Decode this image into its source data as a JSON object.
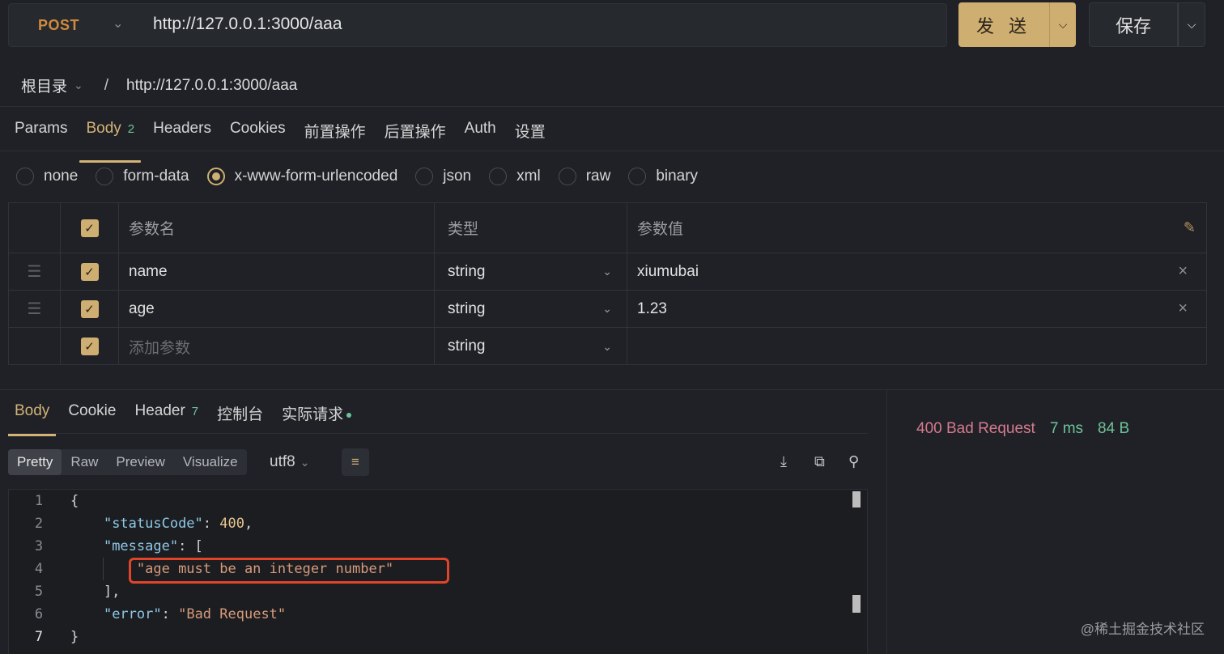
{
  "request": {
    "method": "POST",
    "url": "http://127.0.0.1:3000/aaa",
    "send_label": "发 送",
    "save_label": "保存"
  },
  "breadcrumb": {
    "root": "根目录",
    "separator": "/",
    "path": "http://127.0.0.1:3000/aaa"
  },
  "request_tabs": [
    {
      "label": "Params"
    },
    {
      "label": "Body",
      "badge": "2",
      "active": true
    },
    {
      "label": "Headers"
    },
    {
      "label": "Cookies"
    },
    {
      "label": "前置操作"
    },
    {
      "label": "后置操作"
    },
    {
      "label": "Auth"
    },
    {
      "label": "设置"
    }
  ],
  "body_types": [
    {
      "label": "none"
    },
    {
      "label": "form-data"
    },
    {
      "label": "x-www-form-urlencoded",
      "checked": true
    },
    {
      "label": "json"
    },
    {
      "label": "xml"
    },
    {
      "label": "raw"
    },
    {
      "label": "binary"
    }
  ],
  "params_table": {
    "headers": {
      "name": "参数名",
      "type": "类型",
      "value": "参数值"
    },
    "rows": [
      {
        "name": "name",
        "type": "string",
        "value": "xiumubai"
      },
      {
        "name": "age",
        "type": "string",
        "value": "1.23"
      }
    ],
    "new_row": {
      "placeholder": "添加参数",
      "type": "string"
    }
  },
  "response_tabs": [
    {
      "label": "Body",
      "active": true
    },
    {
      "label": "Cookie"
    },
    {
      "label": "Header",
      "badge": "7"
    },
    {
      "label": "控制台"
    },
    {
      "label": "实际请求"
    }
  ],
  "view_modes": [
    "Pretty",
    "Raw",
    "Preview",
    "Visualize"
  ],
  "active_view_mode": "Pretty",
  "encoding": "utf8",
  "response_body": {
    "line_numbers": [
      "1",
      "2",
      "3",
      "4",
      "5",
      "6",
      "7"
    ],
    "statusCode_key": "\"statusCode\"",
    "statusCode_value": "400",
    "message_key": "\"message\"",
    "message_item": "\"age must be an integer number\"",
    "error_key": "\"error\"",
    "error_value": "\"Bad Request\""
  },
  "status": {
    "code": "400 Bad Request",
    "time": "7 ms",
    "size": "84 B"
  },
  "watermark": "@稀土掘金技术社区",
  "colors": {
    "accent": "#cfae72",
    "success": "#6fc39a",
    "error_status": "#d67a8e",
    "highlight_box": "#e0452a"
  }
}
